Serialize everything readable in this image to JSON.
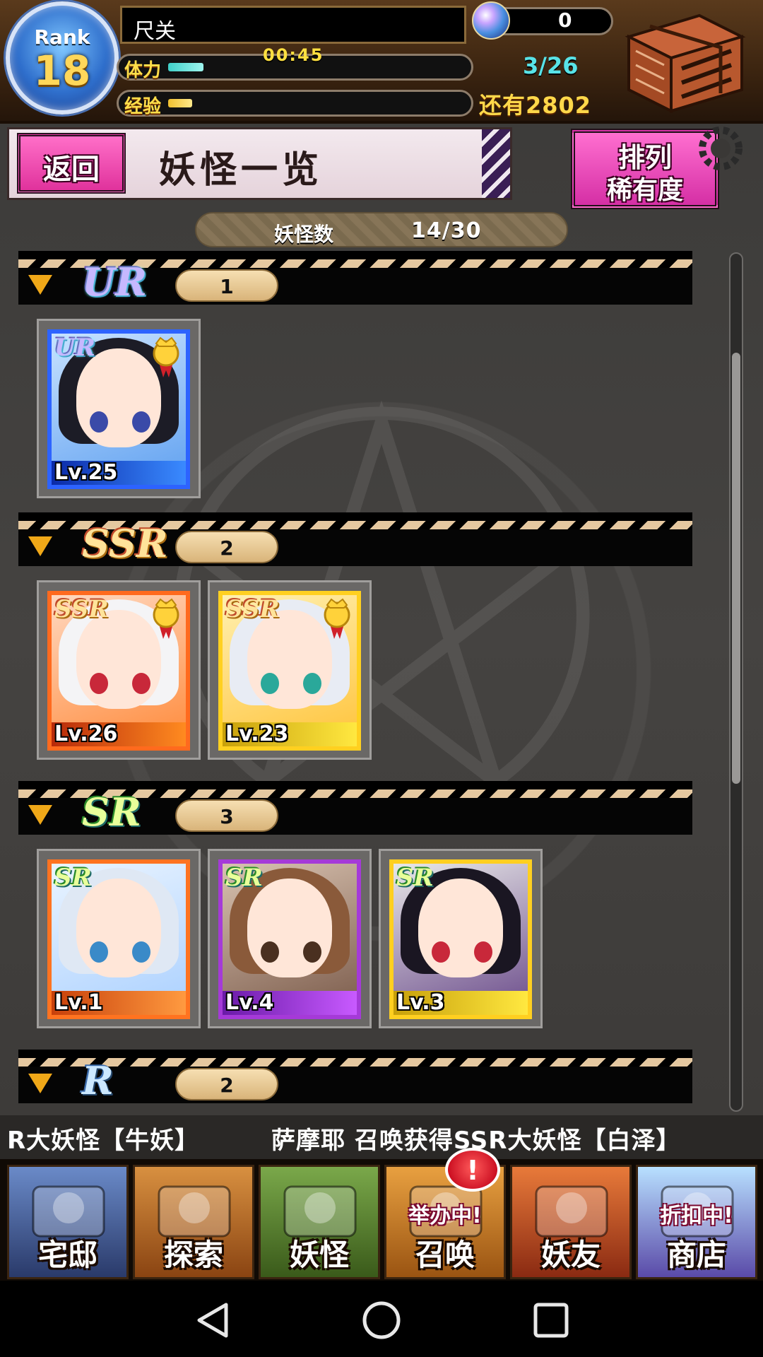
{
  "player": {
    "rank_label": "Rank",
    "rank": "18",
    "name": "尺关",
    "gems": "0",
    "stamina_label": "体力",
    "stamina_timer": "00:45",
    "stamina_count": "3/26",
    "stamina_fraction": 0.12,
    "exp_label": "经验",
    "exp_fraction": 0.08,
    "exp_remaining": "还有2802"
  },
  "header": {
    "back_label": "返回",
    "title": "妖怪一览",
    "sort_label_1": "排列",
    "sort_label_2": "稀有度",
    "count_label": "妖怪数",
    "count_value": "14/30"
  },
  "sections": [
    {
      "rarity": "UR",
      "count": "1",
      "cards": [
        {
          "tag": "UR",
          "level": "Lv.25",
          "medal": true,
          "style": "ur"
        }
      ]
    },
    {
      "rarity": "SSR",
      "count": "2",
      "cards": [
        {
          "tag": "SSR",
          "level": "Lv.26",
          "medal": true,
          "style": "ssr"
        },
        {
          "tag": "SSR",
          "level": "Lv.23",
          "medal": true,
          "style": "ssr-gold"
        }
      ]
    },
    {
      "rarity": "SR",
      "count": "3",
      "cards": [
        {
          "tag": "SR",
          "level": "Lv.1",
          "medal": false,
          "style": "sr-orange"
        },
        {
          "tag": "SR",
          "level": "Lv.4",
          "medal": false,
          "style": "sr-purple"
        },
        {
          "tag": "SR",
          "level": "Lv.3",
          "medal": false,
          "style": "sr-gold"
        }
      ]
    },
    {
      "rarity": "R",
      "count": "2",
      "cards": []
    }
  ],
  "ticker": {
    "message_1": "R大妖怪【牛妖】",
    "message_2": "萨摩耶 召唤获得SSR大妖怪【白泽】"
  },
  "nav": {
    "items": [
      {
        "label": "宅邸",
        "icon": "mansion-icon"
      },
      {
        "label": "探索",
        "icon": "magnifier-map-icon"
      },
      {
        "label": "妖怪",
        "icon": "yokai-scroll-icon"
      },
      {
        "label": "召唤",
        "icon": "summon-star-icon",
        "badge": "举办中!"
      },
      {
        "label": "妖友",
        "icon": "fox-girl-friend-icon"
      },
      {
        "label": "商店",
        "icon": "shop-orb-icon",
        "badge": "折扣中!"
      }
    ],
    "alert": "!"
  },
  "colors": {
    "accent_pink": "#e0329c",
    "gold": "#ffd84a",
    "stamina": "#3fd0c9"
  }
}
